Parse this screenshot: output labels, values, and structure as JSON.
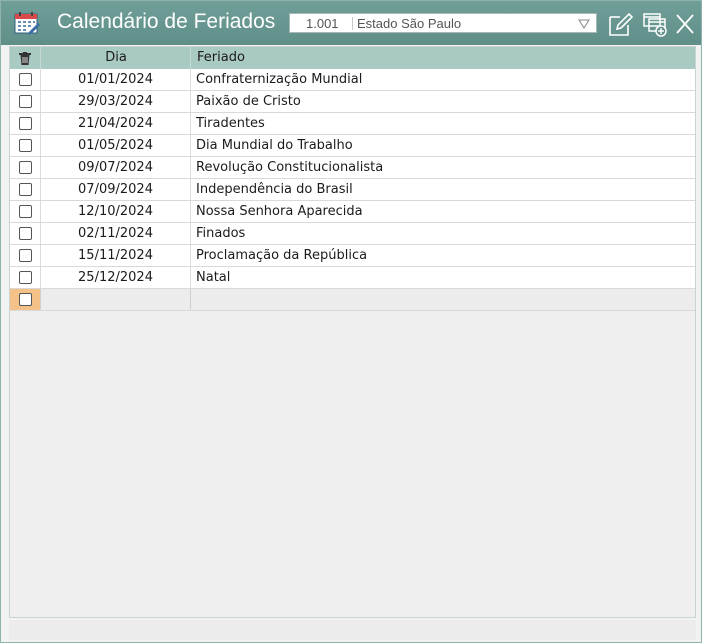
{
  "window": {
    "title": "Calendário de Feriados"
  },
  "filter": {
    "code": "1.001",
    "name": "Estado São Paulo"
  },
  "colors": {
    "titlebar": "#5f8f88",
    "header": "#a9c9c3",
    "new_row_marker": "#f4c189"
  },
  "grid": {
    "columns": [
      "Dia",
      "Feriado"
    ],
    "rows": [
      {
        "dia": "01/01/2024",
        "feriado": "Confraternização Mundial"
      },
      {
        "dia": "29/03/2024",
        "feriado": "Paixão de Cristo"
      },
      {
        "dia": "21/04/2024",
        "feriado": "Tiradentes"
      },
      {
        "dia": "01/05/2024",
        "feriado": "Dia Mundial do Trabalho"
      },
      {
        "dia": "09/07/2024",
        "feriado": "Revolução Constitucionalista"
      },
      {
        "dia": "07/09/2024",
        "feriado": "Independência do Brasil"
      },
      {
        "dia": "12/10/2024",
        "feriado": "Nossa Senhora Aparecida"
      },
      {
        "dia": "02/11/2024",
        "feriado": "Finados"
      },
      {
        "dia": "15/11/2024",
        "feriado": "Proclamação da República"
      },
      {
        "dia": "25/12/2024",
        "feriado": "Natal"
      }
    ]
  },
  "icons": {
    "app": "calendar-icon",
    "dropdown": "chevron-down-icon",
    "edit": "edit-icon",
    "new_window": "new-window-icon",
    "close": "close-icon",
    "delete": "trash-icon"
  }
}
